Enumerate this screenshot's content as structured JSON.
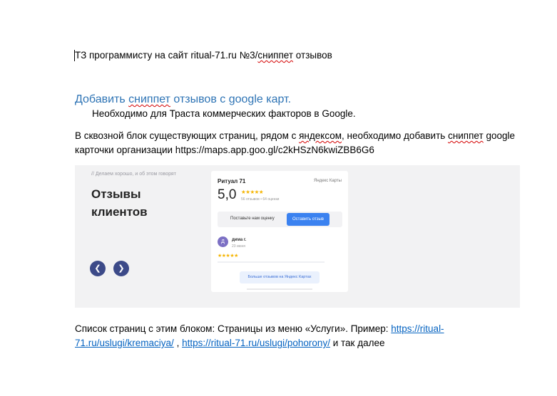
{
  "doc": {
    "title_prefix": "ТЗ программисту на сайт ritual-71.ru №3/",
    "title_word": "сниппет",
    "title_suffix": " отзывов",
    "heading_a": "Добавить ",
    "heading_word": "сниппет",
    "heading_b": " отзывов с google карт.",
    "subline": "Необходимо для Траста коммерческих факторов в Google.",
    "p1_a": "В сквозной блок существующих страниц, рядом с ",
    "p1_word1": "яндексом",
    "p1_b": ", необходимо добавить ",
    "p1_word2": "сниппет",
    "p1_c": " google",
    "p2": "карточки организации https://maps.app.goo.gl/c2kHSzN6kwiZBB6G6",
    "p3_text": "Список страниц с этим блоком: Страницы из меню «Услуги». Пример: ",
    "p3_link1_a": "https://ritual-",
    "p3_link1_b": "71.ru/uslugi/kremaciya/",
    "p4_sep": " , ",
    "p4_link2": "https://ritual-71.ru/uslugi/pohorony/",
    "p4_tail": " и так далее"
  },
  "screenshot": {
    "tagline": "// Делаем хорошо, и об этом говорят",
    "heading_line1": "Отзывы",
    "heading_line2": "клиентов",
    "prev_icon": "chevron-left-icon",
    "next_icon": "chevron-right-icon",
    "card": {
      "org_name": "Ритуал 71",
      "source": "Яндекс Карты",
      "rating": "5,0",
      "stars": "★★★★★",
      "counts": "56 отзывов • 64 оценки",
      "rate_label": "Поставьте нам оценку",
      "rate_button": "Оставить отзыв",
      "avatar_letter": "Д",
      "reviewer": "дима г.",
      "review_date": "23 июня",
      "review_stars": "★★★★★",
      "more_button": "Больше отзывов на Яндекс Картах"
    }
  },
  "colors": {
    "heading": "#2e74b5",
    "link": "#0563c1",
    "nav_button": "#3c4a88",
    "star": "#f5b400",
    "cta": "#3b82f0"
  }
}
